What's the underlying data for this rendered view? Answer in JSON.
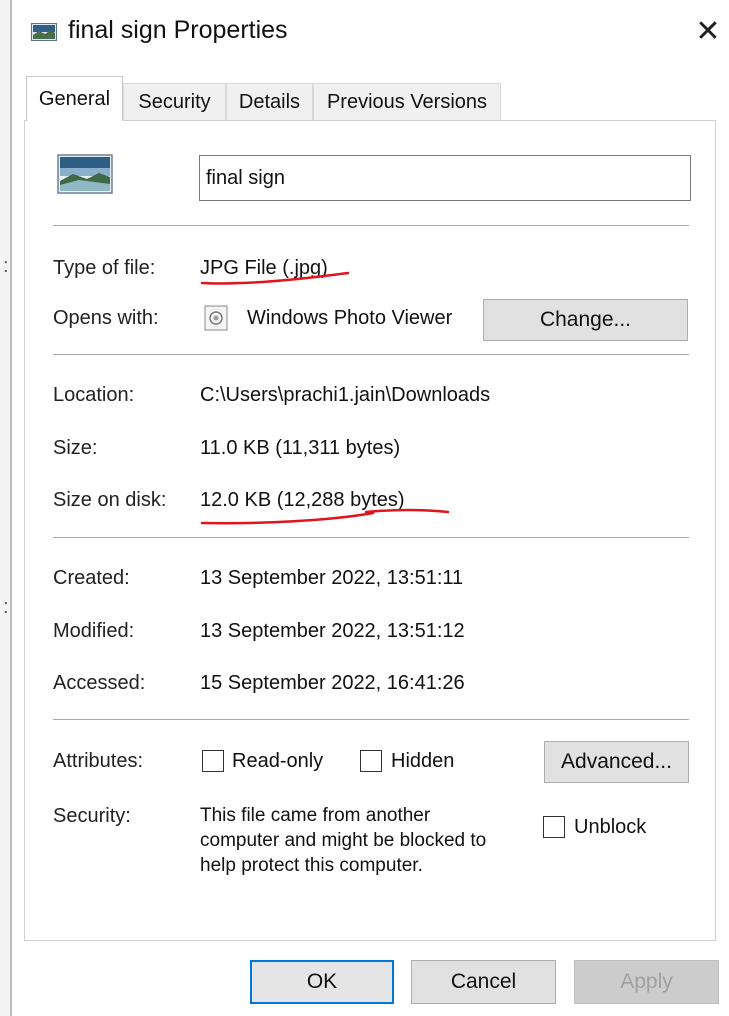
{
  "window": {
    "title": "final sign Properties",
    "close_glyph": "✕"
  },
  "tabs": [
    "General",
    "Security",
    "Details",
    "Previous Versions"
  ],
  "general": {
    "file_name": "final sign",
    "type_label": "Type of file:",
    "type_value": "JPG File (.jpg)",
    "opens_label": "Opens with:",
    "opens_value": "Windows Photo Viewer",
    "change_button": "Change...",
    "location_label": "Location:",
    "location_value": "C:\\Users\\prachi1.jain\\Downloads",
    "size_label": "Size:",
    "size_value": "11.0 KB (11,311 bytes)",
    "size_disk_label": "Size on disk:",
    "size_disk_value": "12.0 KB (12,288 bytes)",
    "created_label": "Created:",
    "created_value": "13 September 2022, 13:51:11",
    "modified_label": "Modified:",
    "modified_value": "13 September 2022, 13:51:12",
    "accessed_label": "Accessed:",
    "accessed_value": "15 September 2022, 16:41:26",
    "attributes_label": "Attributes:",
    "readonly_label": "Read-only",
    "readonly_checked": false,
    "hidden_label": "Hidden",
    "hidden_checked": false,
    "advanced_button": "Advanced...",
    "security_label": "Security:",
    "security_lines": [
      "This file came from another",
      "computer and might be blocked to",
      "help protect this computer."
    ],
    "unblock_label": "Unblock",
    "unblock_checked": false
  },
  "footer": {
    "ok": "OK",
    "cancel": "Cancel",
    "apply": "Apply"
  },
  "colors": {
    "annotation": "#e0141e",
    "accent": "#0078d7"
  },
  "icons": {
    "title": "image-file-icon",
    "file": "image-file-icon",
    "opens": "photo-viewer-icon",
    "close": "close-icon"
  }
}
